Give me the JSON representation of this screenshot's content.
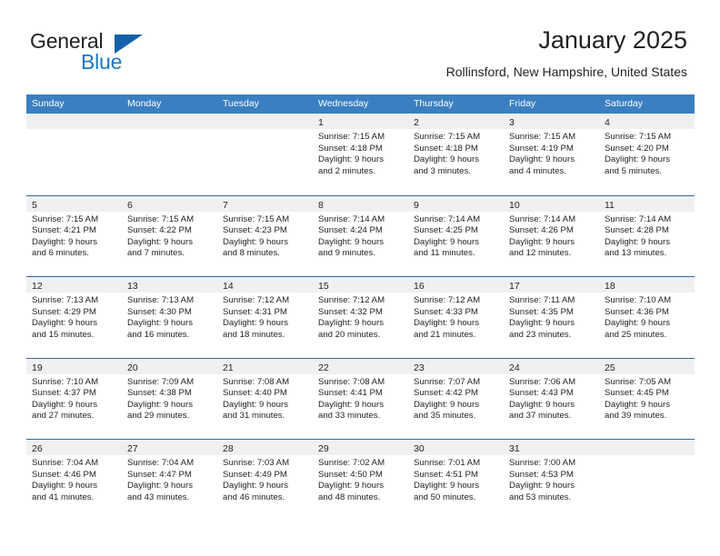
{
  "brand": {
    "name_part1": "General",
    "name_part2": "Blue",
    "logo_icon": "triangle-flag-icon",
    "accent_color": "#1361a8"
  },
  "header": {
    "title": "January 2025",
    "subtitle": "Rollinsford, New Hampshire, United States"
  },
  "calendar": {
    "header_bg_color": "#3a7fc1",
    "daynum_band_color": "#f0f0f0",
    "row_divider_color": "#2f6ca6",
    "day_names": [
      "Sunday",
      "Monday",
      "Tuesday",
      "Wednesday",
      "Thursday",
      "Friday",
      "Saturday"
    ],
    "weeks": [
      [
        {
          "day": "",
          "lines": []
        },
        {
          "day": "",
          "lines": []
        },
        {
          "day": "",
          "lines": []
        },
        {
          "day": "1",
          "lines": [
            "Sunrise: 7:15 AM",
            "Sunset: 4:18 PM",
            "Daylight: 9 hours",
            "and 2 minutes."
          ]
        },
        {
          "day": "2",
          "lines": [
            "Sunrise: 7:15 AM",
            "Sunset: 4:18 PM",
            "Daylight: 9 hours",
            "and 3 minutes."
          ]
        },
        {
          "day": "3",
          "lines": [
            "Sunrise: 7:15 AM",
            "Sunset: 4:19 PM",
            "Daylight: 9 hours",
            "and 4 minutes."
          ]
        },
        {
          "day": "4",
          "lines": [
            "Sunrise: 7:15 AM",
            "Sunset: 4:20 PM",
            "Daylight: 9 hours",
            "and 5 minutes."
          ]
        }
      ],
      [
        {
          "day": "5",
          "lines": [
            "Sunrise: 7:15 AM",
            "Sunset: 4:21 PM",
            "Daylight: 9 hours",
            "and 6 minutes."
          ]
        },
        {
          "day": "6",
          "lines": [
            "Sunrise: 7:15 AM",
            "Sunset: 4:22 PM",
            "Daylight: 9 hours",
            "and 7 minutes."
          ]
        },
        {
          "day": "7",
          "lines": [
            "Sunrise: 7:15 AM",
            "Sunset: 4:23 PM",
            "Daylight: 9 hours",
            "and 8 minutes."
          ]
        },
        {
          "day": "8",
          "lines": [
            "Sunrise: 7:14 AM",
            "Sunset: 4:24 PM",
            "Daylight: 9 hours",
            "and 9 minutes."
          ]
        },
        {
          "day": "9",
          "lines": [
            "Sunrise: 7:14 AM",
            "Sunset: 4:25 PM",
            "Daylight: 9 hours",
            "and 11 minutes."
          ]
        },
        {
          "day": "10",
          "lines": [
            "Sunrise: 7:14 AM",
            "Sunset: 4:26 PM",
            "Daylight: 9 hours",
            "and 12 minutes."
          ]
        },
        {
          "day": "11",
          "lines": [
            "Sunrise: 7:14 AM",
            "Sunset: 4:28 PM",
            "Daylight: 9 hours",
            "and 13 minutes."
          ]
        }
      ],
      [
        {
          "day": "12",
          "lines": [
            "Sunrise: 7:13 AM",
            "Sunset: 4:29 PM",
            "Daylight: 9 hours",
            "and 15 minutes."
          ]
        },
        {
          "day": "13",
          "lines": [
            "Sunrise: 7:13 AM",
            "Sunset: 4:30 PM",
            "Daylight: 9 hours",
            "and 16 minutes."
          ]
        },
        {
          "day": "14",
          "lines": [
            "Sunrise: 7:12 AM",
            "Sunset: 4:31 PM",
            "Daylight: 9 hours",
            "and 18 minutes."
          ]
        },
        {
          "day": "15",
          "lines": [
            "Sunrise: 7:12 AM",
            "Sunset: 4:32 PM",
            "Daylight: 9 hours",
            "and 20 minutes."
          ]
        },
        {
          "day": "16",
          "lines": [
            "Sunrise: 7:12 AM",
            "Sunset: 4:33 PM",
            "Daylight: 9 hours",
            "and 21 minutes."
          ]
        },
        {
          "day": "17",
          "lines": [
            "Sunrise: 7:11 AM",
            "Sunset: 4:35 PM",
            "Daylight: 9 hours",
            "and 23 minutes."
          ]
        },
        {
          "day": "18",
          "lines": [
            "Sunrise: 7:10 AM",
            "Sunset: 4:36 PM",
            "Daylight: 9 hours",
            "and 25 minutes."
          ]
        }
      ],
      [
        {
          "day": "19",
          "lines": [
            "Sunrise: 7:10 AM",
            "Sunset: 4:37 PM",
            "Daylight: 9 hours",
            "and 27 minutes."
          ]
        },
        {
          "day": "20",
          "lines": [
            "Sunrise: 7:09 AM",
            "Sunset: 4:38 PM",
            "Daylight: 9 hours",
            "and 29 minutes."
          ]
        },
        {
          "day": "21",
          "lines": [
            "Sunrise: 7:08 AM",
            "Sunset: 4:40 PM",
            "Daylight: 9 hours",
            "and 31 minutes."
          ]
        },
        {
          "day": "22",
          "lines": [
            "Sunrise: 7:08 AM",
            "Sunset: 4:41 PM",
            "Daylight: 9 hours",
            "and 33 minutes."
          ]
        },
        {
          "day": "23",
          "lines": [
            "Sunrise: 7:07 AM",
            "Sunset: 4:42 PM",
            "Daylight: 9 hours",
            "and 35 minutes."
          ]
        },
        {
          "day": "24",
          "lines": [
            "Sunrise: 7:06 AM",
            "Sunset: 4:43 PM",
            "Daylight: 9 hours",
            "and 37 minutes."
          ]
        },
        {
          "day": "25",
          "lines": [
            "Sunrise: 7:05 AM",
            "Sunset: 4:45 PM",
            "Daylight: 9 hours",
            "and 39 minutes."
          ]
        }
      ],
      [
        {
          "day": "26",
          "lines": [
            "Sunrise: 7:04 AM",
            "Sunset: 4:46 PM",
            "Daylight: 9 hours",
            "and 41 minutes."
          ]
        },
        {
          "day": "27",
          "lines": [
            "Sunrise: 7:04 AM",
            "Sunset: 4:47 PM",
            "Daylight: 9 hours",
            "and 43 minutes."
          ]
        },
        {
          "day": "28",
          "lines": [
            "Sunrise: 7:03 AM",
            "Sunset: 4:49 PM",
            "Daylight: 9 hours",
            "and 46 minutes."
          ]
        },
        {
          "day": "29",
          "lines": [
            "Sunrise: 7:02 AM",
            "Sunset: 4:50 PM",
            "Daylight: 9 hours",
            "and 48 minutes."
          ]
        },
        {
          "day": "30",
          "lines": [
            "Sunrise: 7:01 AM",
            "Sunset: 4:51 PM",
            "Daylight: 9 hours",
            "and 50 minutes."
          ]
        },
        {
          "day": "31",
          "lines": [
            "Sunrise: 7:00 AM",
            "Sunset: 4:53 PM",
            "Daylight: 9 hours",
            "and 53 minutes."
          ]
        },
        {
          "day": "",
          "lines": []
        }
      ]
    ]
  }
}
